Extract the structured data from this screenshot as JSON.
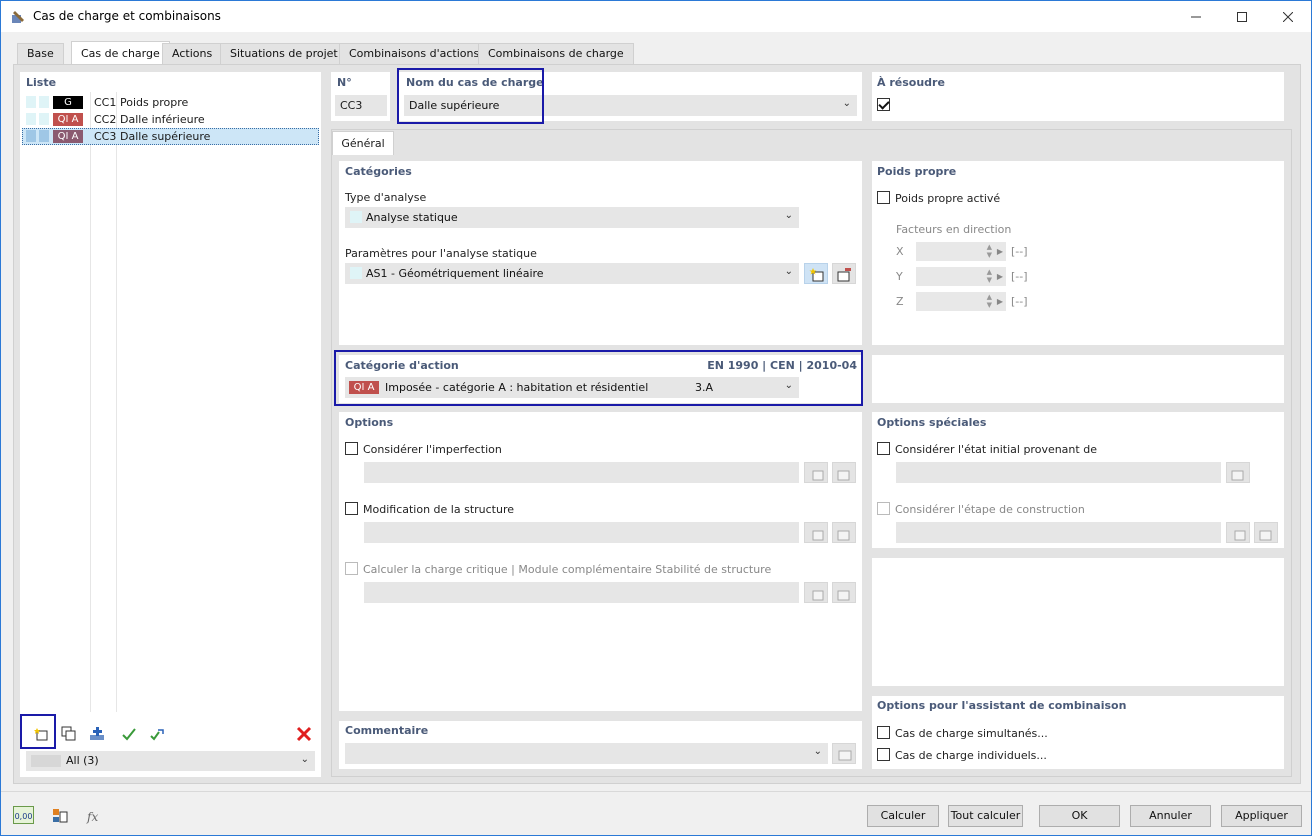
{
  "window": {
    "title": "Cas de charge et combinaisons"
  },
  "tabs": [
    "Base",
    "Cas de charge",
    "Actions",
    "Situations de projet",
    "Combinaisons d'actions",
    "Combinaisons de charge"
  ],
  "list": {
    "title": "Liste",
    "items": [
      {
        "badge": "G",
        "badge_color": "#000000",
        "id": "CC1",
        "name": "Poids propre"
      },
      {
        "badge": "QI A",
        "badge_color": "#c0504d",
        "id": "CC2",
        "name": "Dalle inférieure"
      },
      {
        "badge": "QI A",
        "badge_color": "#8b5a70",
        "id": "CC3",
        "name": "Dalle supérieure"
      }
    ],
    "filter": "All (3)"
  },
  "header": {
    "no_label": "N°",
    "no_value": "CC3",
    "name_label": "Nom du cas de charge",
    "name_value": "Dalle supérieure",
    "solve_label": "À résoudre"
  },
  "subtab": "Général",
  "categories": {
    "title": "Catégories",
    "analysis_label": "Type d'analyse",
    "analysis_value": "Analyse statique",
    "params_label": "Paramètres pour l'analyse statique",
    "params_value": "AS1 - Géométriquement linéaire"
  },
  "selfweight": {
    "title": "Poids propre",
    "active_label": "Poids propre activé",
    "factors_label": "Facteurs en direction",
    "axes": [
      "X",
      "Y",
      "Z"
    ],
    "unit": "[--]"
  },
  "action_category": {
    "title": "Catégorie d'action",
    "norm": "EN 1990 | CEN | 2010-04",
    "badge": "QI A",
    "value": "Imposée - catégorie A : habitation et résidentiel",
    "code": "3.A"
  },
  "options": {
    "title": "Options",
    "imperfection": "Considérer l'imperfection",
    "modification": "Modification de la structure",
    "critical": "Calculer la charge critique | Module complémentaire Stabilité de structure"
  },
  "special_options": {
    "title": "Options spéciales",
    "initial_state": "Considérer l'état initial provenant de",
    "construction_stage": "Considérer l'étape de construction"
  },
  "comment": {
    "title": "Commentaire"
  },
  "wizard": {
    "title": "Options pour l'assistant de combinaison",
    "simultaneous": "Cas de charge simultanés...",
    "individual": "Cas de charge individuels..."
  },
  "buttons": {
    "calc": "Calculer",
    "calc_all": "Tout calculer",
    "ok": "OK",
    "cancel": "Annuler",
    "apply": "Appliquer"
  },
  "bottom_icons": {
    "units": "0,00"
  }
}
